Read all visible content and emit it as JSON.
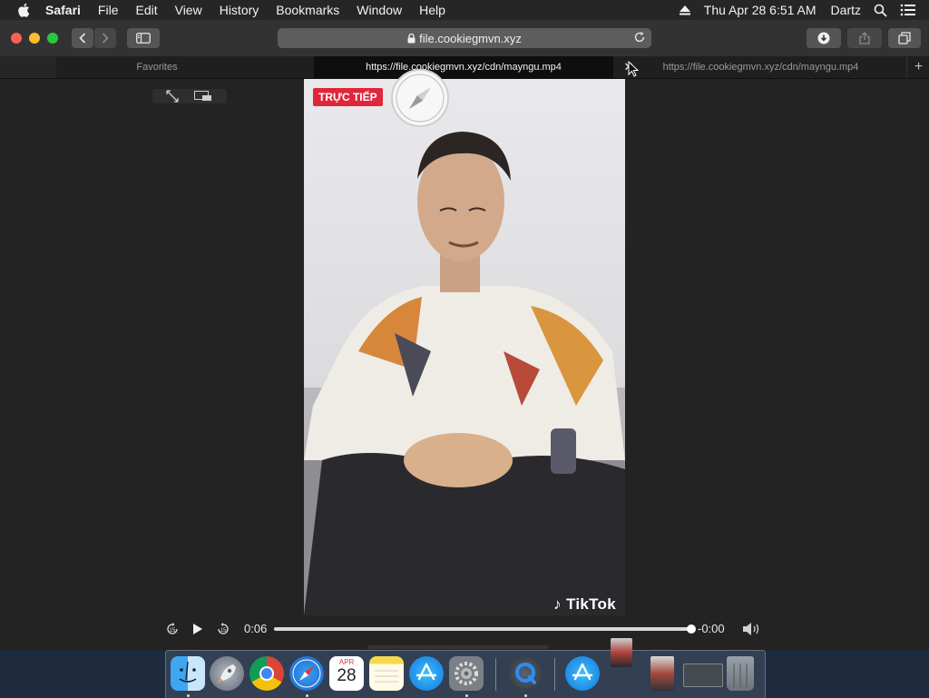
{
  "menubar": {
    "app_name": "Safari",
    "items": [
      "File",
      "Edit",
      "View",
      "History",
      "Bookmarks",
      "Window",
      "Help"
    ],
    "clock": "Thu Apr 28  6:51 AM",
    "user": "Dartz"
  },
  "toolbar": {
    "address_text": "file.cookiegmvn.xyz"
  },
  "tabs": {
    "favorites_label": "Favorites",
    "active_tab": "https://file.cookiegmvn.xyz/cdn/mayngu.mp4",
    "second_tab": "https://file.cookiegmvn.xyz/cdn/mayngu.mp4"
  },
  "video": {
    "live_badge": "TRỰC TIẾP",
    "watermark": "TikTok",
    "elapsed": "0:06",
    "remaining": "-0:00",
    "progress": 1.0
  },
  "dock": {
    "calendar_month": "APR",
    "calendar_day": "28",
    "apps": [
      "finder",
      "launchpad",
      "chrome",
      "safari",
      "calendar",
      "notes",
      "app-store",
      "system-preferences",
      "quicktime",
      "app-store-2",
      "screenshot-1",
      "screenshot-2",
      "trash"
    ]
  },
  "colors": {
    "close": "#fd5f57",
    "minimize": "#febc2e",
    "zoom": "#28c840",
    "live_badge": "#e0263c"
  }
}
